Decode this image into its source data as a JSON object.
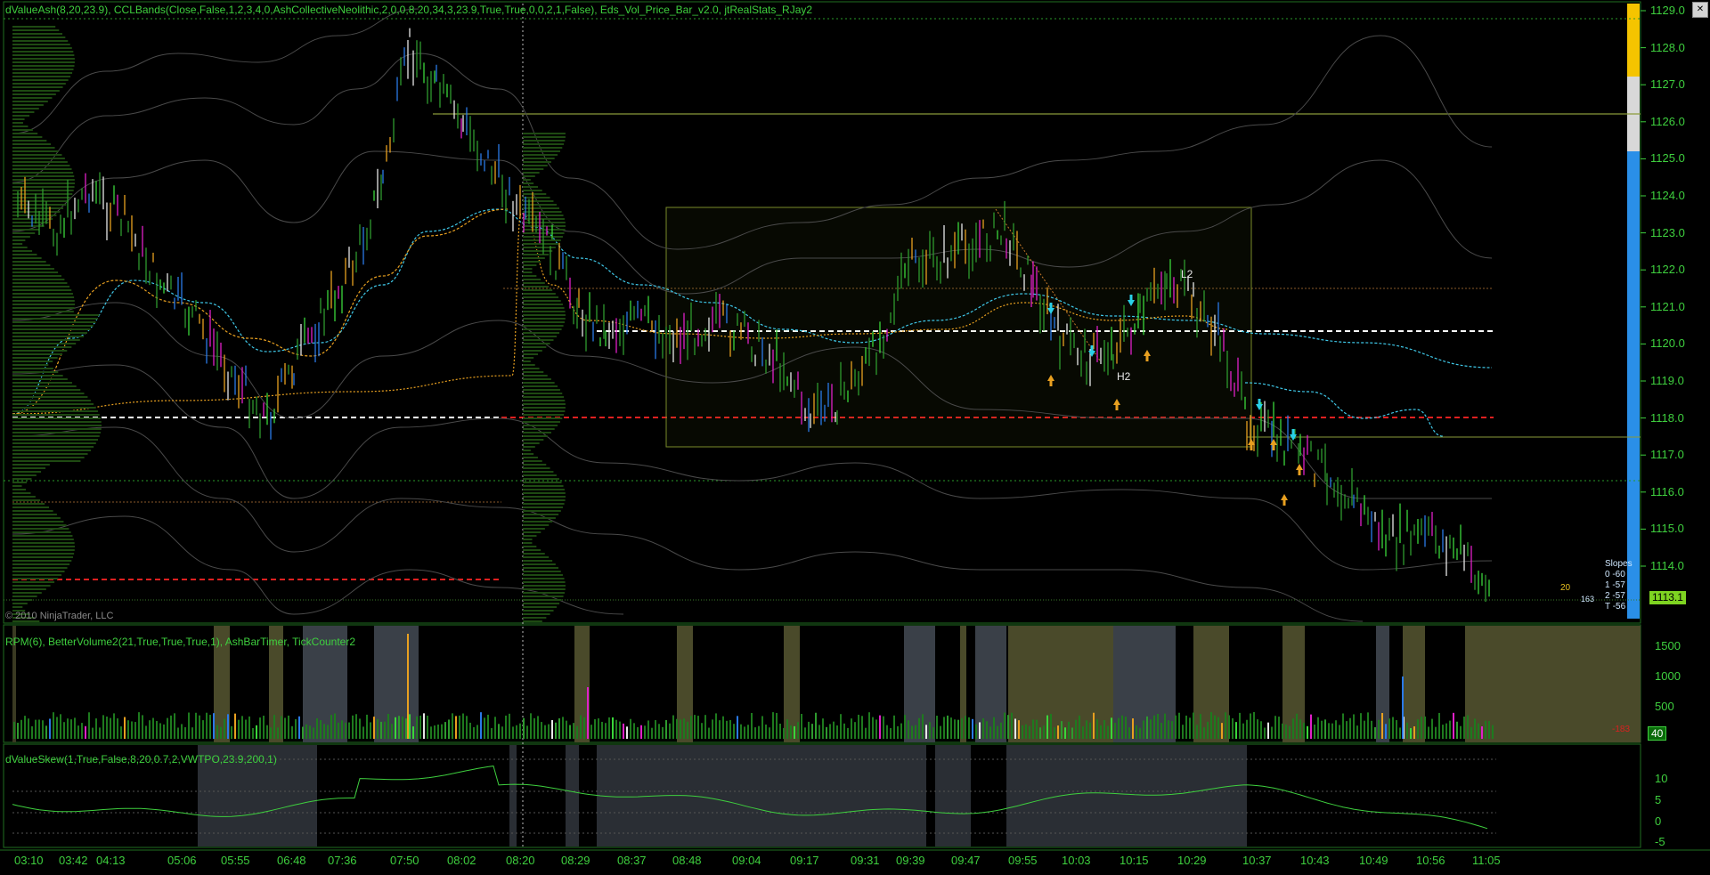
{
  "close_glyph": "✕",
  "price_panel": {
    "indicator_title": "dValueAsh(8,20,23.9), CCLBands(Close,False,1,2,3,4,0,AshCollectiveNeolithic,2,0,0,8,20,34,3,23.9,True,True,0,0,2,1,False), Eds_Vol_Price_Bar_v2.0, jtRealStats_RJay2",
    "copyright": "© 2010 NinjaTrader, LLC",
    "last_price": "1113.1",
    "y_axis": [
      "1129.0",
      "1128.0",
      "1127.0",
      "1126.0",
      "1125.0",
      "1124.0",
      "1123.0",
      "1122.0",
      "1121.0",
      "1120.0",
      "1119.0",
      "1118.0",
      "1117.0",
      "1116.0",
      "1115.0",
      "1114.0"
    ],
    "labels": {
      "l2": "L2",
      "h2": "H2"
    },
    "slope_box": {
      "title": "Slopes",
      "rows": [
        "0  -60",
        "1  -57",
        "2  -57",
        "T  -56"
      ]
    },
    "side_number": "20",
    "small_number": "163",
    "gradient_colors": [
      "#f5c400",
      "#d8d8d8",
      "#2a8fe8"
    ]
  },
  "volume_panel": {
    "indicator_title": "RPM(6), BetterVolume2(21,True,True,True,1), AshBarTimer, TickCounter2",
    "y_axis": [
      "1500",
      "1000",
      "500"
    ],
    "current_volume": "40",
    "neg_value": "-183"
  },
  "skew_panel": {
    "indicator_title": "dValueSkew(1,True,False,8,20,0.7,2,VWTPO,23.9,200,1)",
    "y_axis": [
      "10",
      "5",
      "0",
      "-5"
    ]
  },
  "time_axis": [
    "03:10",
    "03:42",
    "04:13",
    "05:06",
    "05:55",
    "06:48",
    "07:36",
    "07:50",
    "08:02",
    "08:20",
    "08:29",
    "08:37",
    "08:48",
    "09:04",
    "09:17",
    "09:31",
    "09:39",
    "09:47",
    "09:55",
    "10:03",
    "10:15",
    "10:29",
    "10:37",
    "10:43",
    "10:49",
    "10:56",
    "11:05"
  ],
  "colors": {
    "bg": "#000000",
    "text": "#3ecf3e",
    "vwap_orange": "#e8a020",
    "ema_cyan": "#3fc8e8",
    "level_red": "#e02020",
    "level_white": "#ffffff",
    "box": "#7a8a2a"
  }
}
